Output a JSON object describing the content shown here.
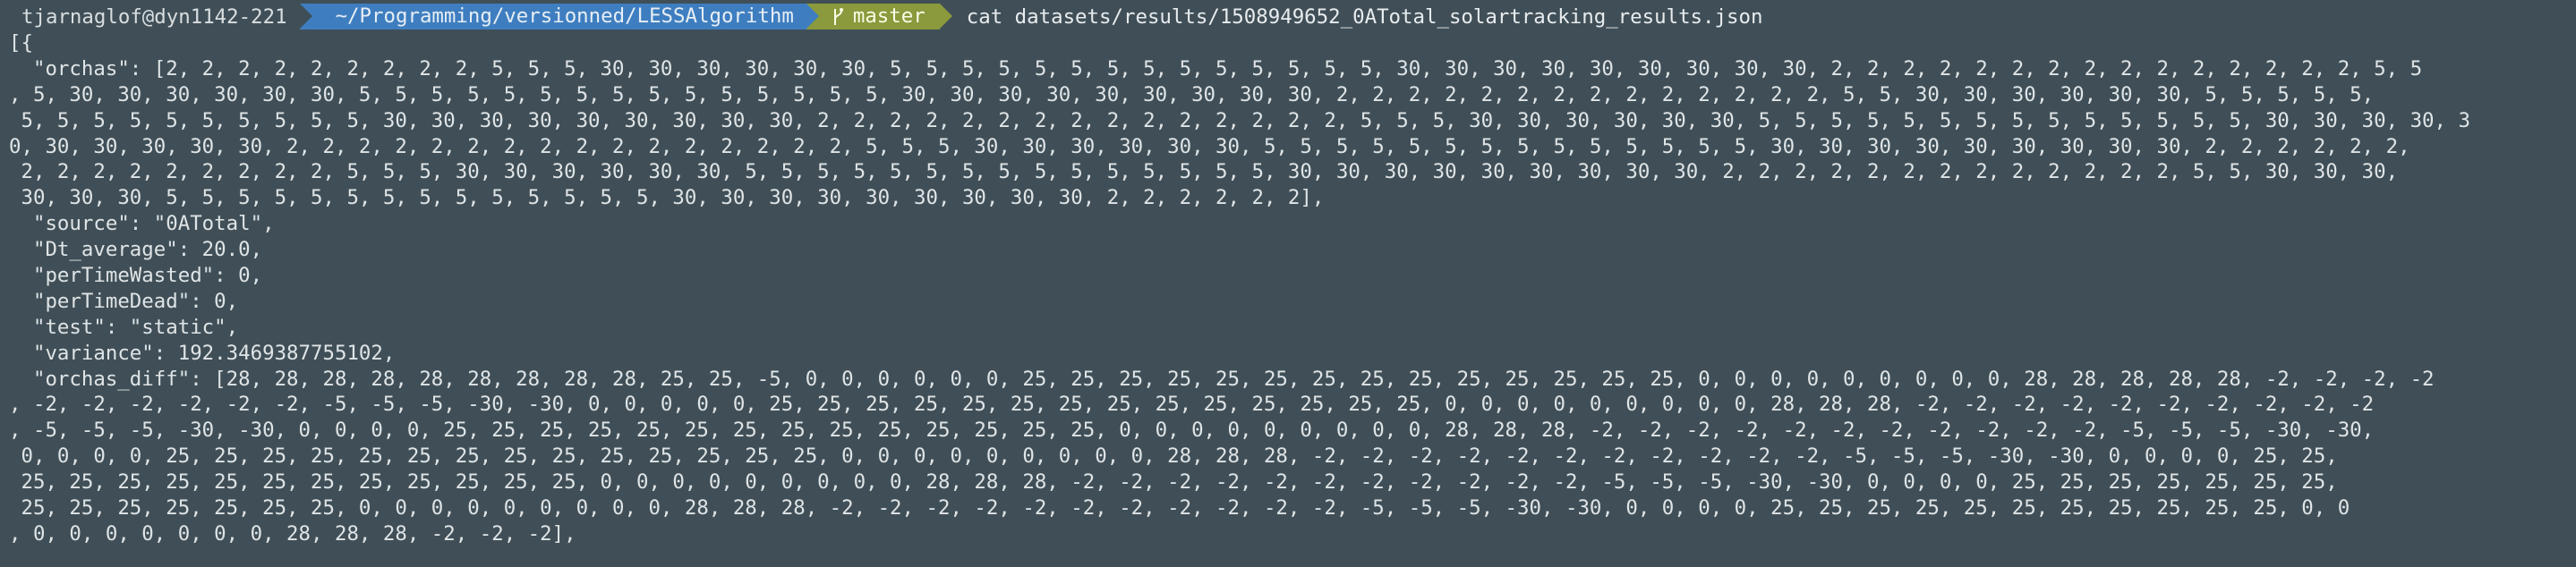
{
  "prompt": {
    "user_host": "tjarnaglof@dyn1142-221",
    "path": "~/Programming/versionned/LESSAlgorithm",
    "branch_icon": "git-branch-icon",
    "branch": "master",
    "command": "cat datasets/results/1508949652_0ATotal_solartracking_results.json"
  },
  "colors": {
    "background": "#404f57",
    "path_segment": "#3e7ec0",
    "git_segment": "#8a9a3c",
    "text": "#dfe4e6"
  },
  "output_lines": [
    "[{",
    "  \"orchas\": [2, 2, 2, 2, 2, 2, 2, 2, 2, 5, 5, 5, 30, 30, 30, 30, 30, 30, 5, 5, 5, 5, 5, 5, 5, 5, 5, 5, 5, 5, 5, 5, 30, 30, 30, 30, 30, 30, 30, 30, 30, 2, 2, 2, 2, 2, 2, 2, 2, 2, 2, 2, 2, 2, 2, 2, 5, 5",
    ", 5, 30, 30, 30, 30, 30, 30, 5, 5, 5, 5, 5, 5, 5, 5, 5, 5, 5, 5, 5, 5, 5, 30, 30, 30, 30, 30, 30, 30, 30, 30, 2, 2, 2, 2, 2, 2, 2, 2, 2, 2, 2, 2, 2, 2, 5, 5, 30, 30, 30, 30, 30, 30, 5, 5, 5, 5, 5,",
    " 5, 5, 5, 5, 5, 5, 5, 5, 5, 5, 30, 30, 30, 30, 30, 30, 30, 30, 30, 2, 2, 2, 2, 2, 2, 2, 2, 2, 2, 2, 2, 2, 2, 2, 5, 5, 5, 30, 30, 30, 30, 30, 30, 5, 5, 5, 5, 5, 5, 5, 5, 5, 5, 5, 5, 5, 5, 30, 30, 30, 30, 3",
    "0, 30, 30, 30, 30, 30, 2, 2, 2, 2, 2, 2, 2, 2, 2, 2, 2, 2, 2, 2, 2, 2, 5, 5, 5, 30, 30, 30, 30, 30, 30, 5, 5, 5, 5, 5, 5, 5, 5, 5, 5, 5, 5, 5, 5, 30, 30, 30, 30, 30, 30, 30, 30, 30, 2, 2, 2, 2, 2, 2,",
    " 2, 2, 2, 2, 2, 2, 2, 2, 2, 5, 5, 5, 30, 30, 30, 30, 30, 30, 5, 5, 5, 5, 5, 5, 5, 5, 5, 5, 5, 5, 5, 5, 5, 30, 30, 30, 30, 30, 30, 30, 30, 30, 2, 2, 2, 2, 2, 2, 2, 2, 2, 2, 2, 2, 2, 5, 5, 30, 30, 30,",
    " 30, 30, 30, 5, 5, 5, 5, 5, 5, 5, 5, 5, 5, 5, 5, 5, 5, 30, 30, 30, 30, 30, 30, 30, 30, 30, 2, 2, 2, 2, 2, 2],",
    "  \"source\": \"0ATotal\",",
    "  \"Dt_average\": 20.0,",
    "  \"perTimeWasted\": 0,",
    "  \"perTimeDead\": 0,",
    "  \"test\": \"static\",",
    "  \"variance\": 192.3469387755102,",
    "  \"orchas_diff\": [28, 28, 28, 28, 28, 28, 28, 28, 28, 25, 25, -5, 0, 0, 0, 0, 0, 0, 25, 25, 25, 25, 25, 25, 25, 25, 25, 25, 25, 25, 25, 25, 0, 0, 0, 0, 0, 0, 0, 0, 0, 28, 28, 28, 28, 28, -2, -2, -2, -2",
    ", -2, -2, -2, -2, -2, -2, -5, -5, -5, -30, -30, 0, 0, 0, 0, 0, 25, 25, 25, 25, 25, 25, 25, 25, 25, 25, 25, 25, 25, 25, 0, 0, 0, 0, 0, 0, 0, 0, 0, 28, 28, 28, -2, -2, -2, -2, -2, -2, -2, -2, -2, -2",
    ", -5, -5, -5, -30, -30, 0, 0, 0, 0, 25, 25, 25, 25, 25, 25, 25, 25, 25, 25, 25, 25, 25, 25, 0, 0, 0, 0, 0, 0, 0, 0, 0, 28, 28, 28, -2, -2, -2, -2, -2, -2, -2, -2, -2, -2, -2, -5, -5, -5, -30, -30,",
    " 0, 0, 0, 0, 25, 25, 25, 25, 25, 25, 25, 25, 25, 25, 25, 25, 25, 25, 0, 0, 0, 0, 0, 0, 0, 0, 0, 28, 28, 28, -2, -2, -2, -2, -2, -2, -2, -2, -2, -2, -2, -5, -5, -5, -30, -30, 0, 0, 0, 0, 25, 25,",
    " 25, 25, 25, 25, 25, 25, 25, 25, 25, 25, 25, 25, 0, 0, 0, 0, 0, 0, 0, 0, 0, 28, 28, 28, -2, -2, -2, -2, -2, -2, -2, -2, -2, -2, -2, -5, -5, -5, -30, -30, 0, 0, 0, 0, 25, 25, 25, 25, 25, 25, 25,",
    " 25, 25, 25, 25, 25, 25, 25, 0, 0, 0, 0, 0, 0, 0, 0, 0, 28, 28, 28, -2, -2, -2, -2, -2, -2, -2, -2, -2, -2, -2, -5, -5, -5, -30, -30, 0, 0, 0, 0, 25, 25, 25, 25, 25, 25, 25, 25, 25, 25, 25, 0, 0",
    ", 0, 0, 0, 0, 0, 0, 0, 28, 28, 28, -2, -2, -2],"
  ]
}
